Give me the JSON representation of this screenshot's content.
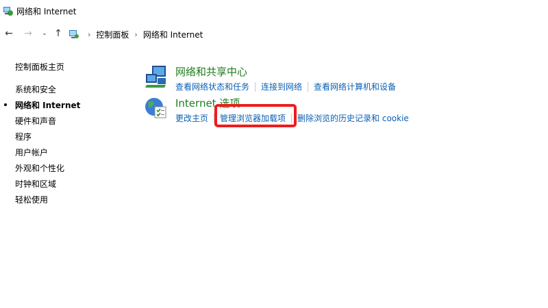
{
  "window": {
    "title": "网络和 Internet",
    "title_icon": "network-globe-icon"
  },
  "address_bar": {
    "back_icon": "arrow-left-icon",
    "forward_icon": "arrow-right-icon",
    "recent_icon": "chevron-down-icon",
    "up_icon": "arrow-up-icon",
    "location_icon": "control-panel-icon",
    "breadcrumbs": [
      "控制面板",
      "网络和 Internet"
    ]
  },
  "sidebar": {
    "home": "控制面板主页",
    "items": [
      {
        "label": "系统和安全",
        "current": false
      },
      {
        "label": "网络和 Internet",
        "current": true
      },
      {
        "label": "硬件和声音",
        "current": false
      },
      {
        "label": "程序",
        "current": false
      },
      {
        "label": "用户帐户",
        "current": false
      },
      {
        "label": "外观和个性化",
        "current": false
      },
      {
        "label": "时钟和区域",
        "current": false
      },
      {
        "label": "轻松使用",
        "current": false
      }
    ]
  },
  "sections": [
    {
      "title": "网络和共享中心",
      "icon": "network-sharing-center-icon",
      "links": [
        "查看网络状态和任务",
        "连接到网络",
        "查看网络计算机和设备"
      ]
    },
    {
      "title": "Internet 选项",
      "icon": "internet-options-icon",
      "links": [
        "更改主页",
        "管理浏览器加载项",
        "删除浏览的历史记录和 cookie"
      ]
    }
  ],
  "colors": {
    "section_title": "#1e7c1e",
    "link": "#0a5fb4",
    "highlight": "#ee1c1c"
  }
}
